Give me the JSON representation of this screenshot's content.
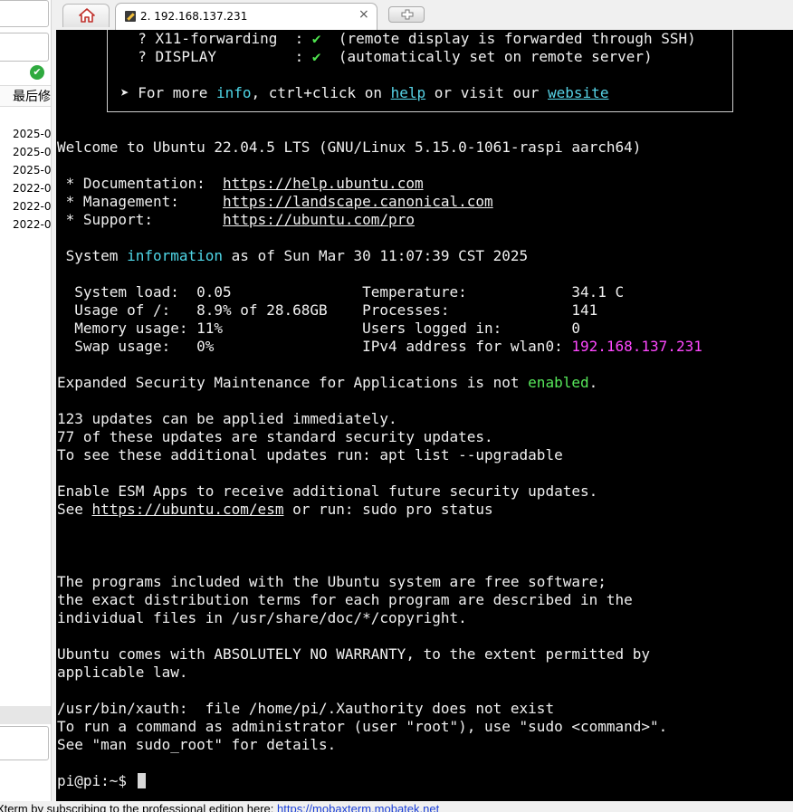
{
  "side_panel": {
    "header": "最后修",
    "dates": [
      "2025-0",
      "2025-0",
      "2025-0",
      "2022-0",
      "2022-0",
      "2022-0"
    ]
  },
  "tab_bar": {
    "session_tab_title": "2. 192.168.137.231",
    "close_glyph": "×"
  },
  "terminal": {
    "banner": {
      "x11_line": "  ? X11-forwarding  : ",
      "x11_check": "✔",
      "x11_note": "  (remote display is forwarded through SSH)",
      "display_line": "  ? DISPLAY         : ",
      "display_check": "✔",
      "display_note": "  (automatically set on remote server)",
      "more_prefix": "➤ For more ",
      "info_word": "info",
      "more_mid": ", ctrl+click on ",
      "help_link": "help",
      "more_mid2": " or visit our ",
      "website_link": "website"
    },
    "welcome": "Welcome to Ubuntu 22.04.5 LTS (GNU/Linux 5.15.0-1061-raspi aarch64)",
    "doc_label": " * Documentation:  ",
    "doc_url": "https://help.ubuntu.com",
    "mgmt_label": " * Management:     ",
    "mgmt_url": "https://landscape.canonical.com",
    "support_label": " * Support:        ",
    "support_url": "https://ubuntu.com/pro",
    "sysinfo_prefix": " System ",
    "sysinfo_word": "information",
    "sysinfo_suffix": " as of Sun Mar 30 11:07:39 CST 2025",
    "stats": {
      "load_line": "  System load:  0.05               Temperature:            34.1 C",
      "usage_line": "  Usage of /:   8.9% of 28.68GB    Processes:              141",
      "memory_line": "  Memory usage: 11%                Users logged in:        0",
      "swap_line": "  Swap usage:   0%                 IPv4 address for wlan0: ",
      "ipv4": "192.168.137.231"
    },
    "esm_prefix": "Expanded Security Maintenance for Applications is not ",
    "esm_status": "enabled",
    "esm_suffix": ".",
    "updates_1": "123 updates can be applied immediately.",
    "updates_2": "77 of these updates are standard security updates.",
    "updates_3": "To see these additional updates run: apt list --upgradable",
    "esm_apps_1": "Enable ESM Apps to receive additional future security updates.",
    "esm_apps_2_prefix": "See ",
    "esm_apps_url": "https://ubuntu.com/esm",
    "esm_apps_2_suffix": " or run: sudo pro status",
    "legal_1": "The programs included with the Ubuntu system are free software;",
    "legal_2": "the exact distribution terms for each program are described in the",
    "legal_3": "individual files in /usr/share/doc/*/copyright.",
    "warranty_1": "Ubuntu comes with ABSOLUTELY NO WARRANTY, to the extent permitted by",
    "warranty_2": "applicable law.",
    "xauth": "/usr/bin/xauth:  file /home/pi/.Xauthority does not exist",
    "sudo_1": "To run a command as administrator (user \"root\"), use \"sudo <command>\".",
    "sudo_2": "See \"man sudo_root\" for details.",
    "prompt": "pi@pi:~$ "
  },
  "status_bar": {
    "message": "Xterm by subscribing to the professional edition here:  ",
    "url": "https://mobaxterm.mobatek.net"
  },
  "colors": {
    "terminal_bg": "#000000",
    "cyan": "#4fd7e8",
    "green": "#57e85b",
    "magenta": "#ff48ff",
    "status_link": "#1a3fd6"
  }
}
